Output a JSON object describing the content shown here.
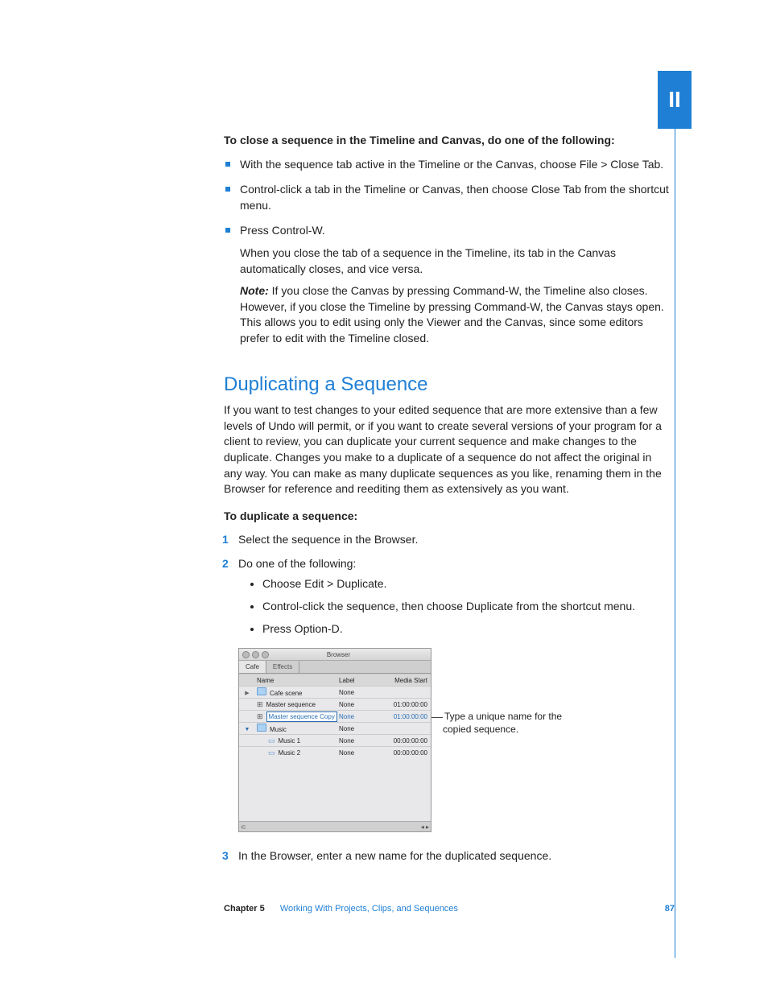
{
  "sectionTab": "II",
  "closeHeading": "To close a sequence in the Timeline and Canvas, do one of the following:",
  "closeBullets": [
    "With the sequence tab active in the Timeline or the Canvas, choose File > Close Tab.",
    "Control-click a tab in the Timeline or Canvas, then choose Close Tab from the shortcut menu.",
    "Press Control-W."
  ],
  "closePara1": "When you close the tab of a sequence in the Timeline, its tab in the Canvas automatically closes, and vice versa.",
  "noteLabel": "Note:",
  "notePara": "If you close the Canvas by pressing Command-W, the Timeline also closes. However, if you close the Timeline by pressing Command-W, the Canvas stays open. This allows you to edit using only the Viewer and the Canvas, since some editors prefer to edit with the Timeline closed.",
  "dupHeading": "Duplicating a Sequence",
  "dupPara": "If you want to test changes to your edited sequence that are more extensive than a few levels of Undo will permit, or if you want to create several versions of your program for a client to review, you can duplicate your current sequence and make changes to the duplicate. Changes you make to a duplicate of a sequence do not affect the original in any way. You can make as many duplicate sequences as you like, renaming them in the Browser for reference and reediting them as extensively as you want.",
  "dupStepsHeading": "To duplicate a sequence:",
  "step1": "Select the sequence in the Browser.",
  "step2lead": "Do one of the following:",
  "step2Options": [
    "Choose Edit > Duplicate.",
    "Control-click the sequence, then choose Duplicate from the shortcut menu.",
    "Press Option-D."
  ],
  "step3": "In the Browser, enter a new name for the duplicated sequence.",
  "callout": "Type a unique name for the copied sequence.",
  "browser": {
    "title": "Browser",
    "tab1": "Cafe",
    "tab2": "Effects",
    "colName": "Name",
    "colLabel": "Label",
    "colMedia": "Media Start",
    "rows": [
      {
        "icon": "folder",
        "arrow": "right",
        "name": "Cafe scene",
        "label": "None",
        "media": ""
      },
      {
        "icon": "seq",
        "arrow": "",
        "name": "Master sequence",
        "label": "None",
        "media": "01:00:00:00"
      },
      {
        "icon": "seq",
        "arrow": "",
        "name": "Master sequence Copy",
        "label": "None",
        "media": "01:00:00:00",
        "selected": true
      },
      {
        "icon": "folder",
        "arrow": "down",
        "name": "Music",
        "label": "None",
        "media": ""
      },
      {
        "icon": "clip",
        "arrow": "",
        "name": "Music 1",
        "label": "None",
        "media": "00:00:00:00",
        "indent": true
      },
      {
        "icon": "clip",
        "arrow": "",
        "name": "Music 2",
        "label": "None",
        "media": "00:00:00:00",
        "indent": true
      }
    ]
  },
  "footer": {
    "chapter": "Chapter 5",
    "title": "Working With Projects, Clips, and Sequences",
    "page": "87"
  }
}
